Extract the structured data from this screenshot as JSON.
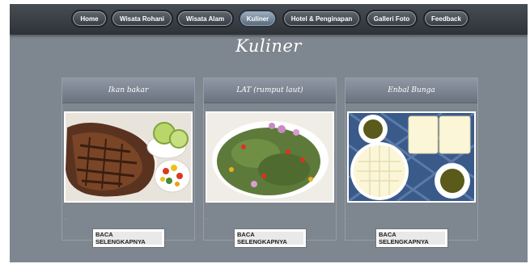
{
  "nav": {
    "items": [
      {
        "label": "Home"
      },
      {
        "label": "Wisata Rohani"
      },
      {
        "label": "Wisata Alam"
      },
      {
        "label": "Kuliner"
      },
      {
        "label": "Hotel & Penginapan"
      },
      {
        "label": "Galleri Foto"
      },
      {
        "label": "Feedback"
      }
    ],
    "active": "Kuliner"
  },
  "page": {
    "title": "Kuliner"
  },
  "cards": [
    {
      "title": "Ikan bakar",
      "image": "grilled-fish-photo",
      "dash": "–",
      "button": "BACA SELENGKAPNYA"
    },
    {
      "title": "LAT (rumput laut)",
      "image": "seaweed-salad-photo",
      "dash": "–",
      "button": "BACA SELENGKAPNYA"
    },
    {
      "title": "Enbal Bunga",
      "image": "enbal-cassava-cake-photo",
      "dash": "–",
      "button": "BACA SELENGKAPNYA"
    }
  ],
  "colors": {
    "background": "#7e868f",
    "topbar": "#3a3f45",
    "nav_active": "#7d91a6"
  }
}
